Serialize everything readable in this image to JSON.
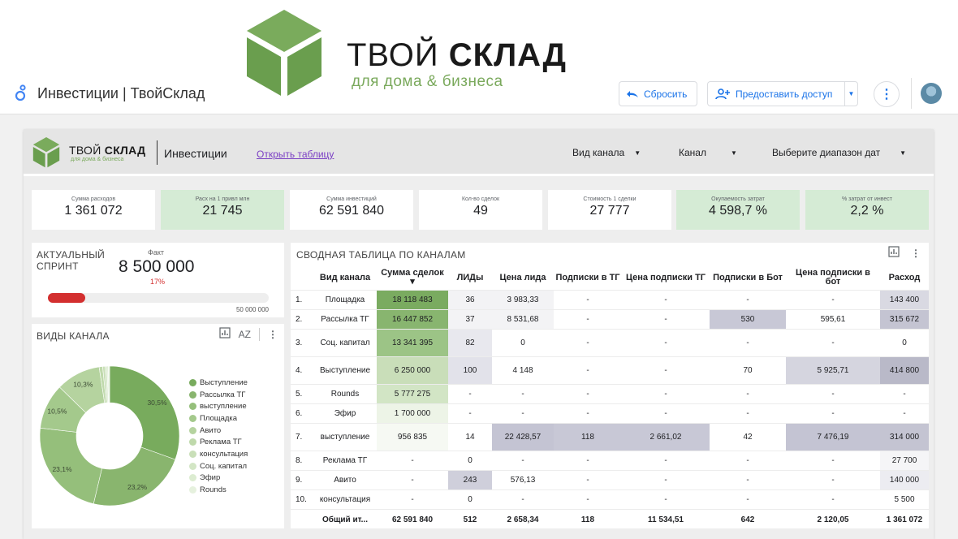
{
  "brand": {
    "line1_light": "ТВОЙ",
    "line1_bold": "СКЛАД",
    "line2": "для дома & бизнеса"
  },
  "app": {
    "title": "Инвестиции | ТвойСклад",
    "reset_label": "Сбросить",
    "share_label": "Предоставить доступ"
  },
  "report": {
    "brand1_light": "ТВОЙ",
    "brand1_bold": "СКЛАД",
    "brand2": "для дома & бизнеса",
    "title": "Инвестиции",
    "link": "Открыть таблицу",
    "filters": [
      "Вид канала",
      "Канал",
      "Выберите диапазон дат"
    ]
  },
  "kpis": [
    {
      "label": "Сумма расходов",
      "value": "1 361 072",
      "highlight": false
    },
    {
      "label": "Расх на 1 привл млн",
      "value": "21 745",
      "highlight": true
    },
    {
      "label": "Сумма инвестиций",
      "value": "62 591 840",
      "highlight": false
    },
    {
      "label": "Кол-во сделок",
      "value": "49",
      "highlight": false
    },
    {
      "label": "Стоимость 1 сделки",
      "value": "27 777",
      "highlight": false
    },
    {
      "label": "Окупаемость затрат",
      "value": "4 598,7 %",
      "highlight": true
    },
    {
      "label": "% затрат от инвест",
      "value": "2,2 %",
      "highlight": true
    }
  ],
  "sprint": {
    "title_line1": "АКТУАЛЬНЫЙ",
    "title_line2": "СПРИНТ",
    "fact_label": "Факт",
    "fact_value": "8 500 000",
    "percent": "17%",
    "progress": 0.17,
    "target": "50 000 000",
    "bar_color": "#d32f2f"
  },
  "channel_types": {
    "title": "ВИДЫ КАНАЛА",
    "sort_label": "AZ",
    "chart_data": {
      "type": "pie",
      "categories": [
        "Выступление",
        "Рассылка ТГ",
        "выступление",
        "Площадка",
        "Авито",
        "Реклама ТГ",
        "консультация",
        "Соц. капитал",
        "Эфир",
        "Rounds"
      ],
      "values": [
        30.5,
        23.2,
        23.1,
        10.5,
        10.3,
        0.8,
        0.6,
        0.4,
        0.3,
        0.3
      ],
      "slice_labels": [
        "30,5%",
        "23,2%",
        "23,1%",
        "10,5%",
        "10,3%",
        "",
        "",
        "",
        "",
        ""
      ],
      "colors": [
        "#78ab5d",
        "#89b56e",
        "#95bf7b",
        "#a4c98c",
        "#b5d39f",
        "#bfd9ab",
        "#c9dfb8",
        "#d3e6c5",
        "#dcecd1",
        "#e6f1de"
      ],
      "donut": true,
      "legend": "right"
    }
  },
  "pivot": {
    "title": "СВОДНАЯ ТАБЛИЦА ПО КАНАЛАМ",
    "headers": [
      "",
      "Вид канала",
      "Сумма сделок ▾",
      "ЛИДы",
      "Цена лида",
      "Подписки в ТГ",
      "Цена подписки ТГ",
      "Подписки в Бот",
      "Цена подписки в бот",
      "Расход"
    ],
    "rows": [
      [
        "1.",
        "Площадка",
        "18 118 483",
        "36",
        "3 983,33",
        "-",
        "-",
        "-",
        "-",
        "143 400"
      ],
      [
        "2.",
        "Рассылка ТГ",
        "16 447 852",
        "37",
        "8 531,68",
        "-",
        "-",
        "530",
        "595,61",
        "315 672"
      ],
      [
        "3.",
        "Соц. капитал",
        "13 341 395",
        "82",
        "0",
        "-",
        "-",
        "-",
        "-",
        "0"
      ],
      [
        "4.",
        "Выступление",
        "6 250 000",
        "100",
        "4 148",
        "-",
        "-",
        "70",
        "5 925,71",
        "414 800"
      ],
      [
        "5.",
        "Rounds",
        "5 777 275",
        "-",
        "-",
        "-",
        "-",
        "-",
        "-",
        "-"
      ],
      [
        "6.",
        "Эфир",
        "1 700 000",
        "-",
        "-",
        "-",
        "-",
        "-",
        "-",
        "-"
      ],
      [
        "7.",
        "выступление",
        "956 835",
        "14",
        "22 428,57",
        "118",
        "2 661,02",
        "42",
        "7 476,19",
        "314 000"
      ],
      [
        "8.",
        "Реклама ТГ",
        "-",
        "0",
        "-",
        "-",
        "-",
        "-",
        "-",
        "27 700"
      ],
      [
        "9.",
        "Авито",
        "-",
        "243",
        "576,13",
        "-",
        "-",
        "-",
        "-",
        "140 000"
      ],
      [
        "10.",
        "консультация",
        "-",
        "0",
        "-",
        "-",
        "-",
        "-",
        "-",
        "5 500"
      ]
    ],
    "total": [
      "",
      "Общий ит...",
      "62 591 840",
      "512",
      "2 658,34",
      "118",
      "11 534,51",
      "642",
      "2 120,05",
      "1 361 072"
    ],
    "cell_colors": [
      [
        null,
        null,
        "#7aab60",
        "#f3f3f5",
        "#f3f3f5",
        null,
        null,
        null,
        null,
        "#d9d9e2"
      ],
      [
        null,
        null,
        "#88b56f",
        "#f3f3f5",
        "#f3f3f5",
        null,
        null,
        "#c8c8d6",
        null,
        "#c4c4d2"
      ],
      [
        null,
        null,
        "#9cc486",
        "#e8e8ee",
        null,
        null,
        null,
        null,
        null,
        null
      ],
      [
        null,
        null,
        "#c9deb9",
        "#e2e2ea",
        null,
        null,
        null,
        null,
        "#d5d5df",
        "#b9b9c8"
      ],
      [
        null,
        null,
        "#d2e5c5",
        null,
        null,
        null,
        null,
        null,
        null,
        null
      ],
      [
        null,
        null,
        "#edf4e7",
        null,
        null,
        null,
        null,
        null,
        null,
        null
      ],
      [
        null,
        null,
        "#f6f9f3",
        null,
        "#c4c4d3",
        "#c8c8d6",
        "#c8c8d6",
        null,
        "#c4c4d3",
        "#c4c4d2"
      ],
      [
        null,
        null,
        null,
        null,
        null,
        null,
        null,
        null,
        null,
        "#f5f5f7"
      ],
      [
        null,
        null,
        null,
        "#cfcfdb",
        null,
        null,
        null,
        null,
        null,
        "#ececf1"
      ],
      [
        null,
        null,
        null,
        null,
        null,
        null,
        null,
        null,
        null,
        null
      ]
    ]
  }
}
